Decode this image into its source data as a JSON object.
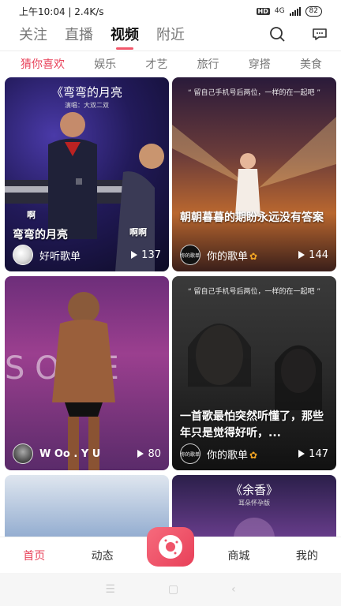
{
  "status": {
    "time": "上午10:04",
    "speed": "2.4K/s",
    "hd": "HD",
    "network": "4G",
    "battery": "82"
  },
  "top_tabs": [
    {
      "label": "关注"
    },
    {
      "label": "直播"
    },
    {
      "label": "视频"
    },
    {
      "label": "附近"
    }
  ],
  "categories": [
    {
      "label": "猜你喜欢"
    },
    {
      "label": "娱乐"
    },
    {
      "label": "才艺"
    },
    {
      "label": "旅行"
    },
    {
      "label": "穿搭"
    },
    {
      "label": "美食"
    }
  ],
  "cards": [
    {
      "song_title": "《弯弯的月亮",
      "song_sub": "演唱：大双二双",
      "tag1": "啊",
      "tag2": "啊啊",
      "title": "弯弯的月亮",
      "author": "好听歌单",
      "plays": "137"
    },
    {
      "banner": "“ 留自己手机号后两位，一样的在一起吧 ”",
      "title": "朝朝暮暮的期盼永远没有答案",
      "author": "你的歌单",
      "avatar_text": "你的歌单",
      "plays": "144"
    },
    {
      "title": "",
      "author": "W Oo . Y U",
      "plays": "80"
    },
    {
      "banner": "“ 留自己手机号后两位，一样的在一起吧 ”",
      "title": "一首歌最怕突然听懂了，那些年只是觉得好听，...",
      "author": "你的歌单",
      "avatar_text": "你的歌单",
      "plays": "147"
    },
    {
      "title": ""
    },
    {
      "song_title": "《余香》",
      "song_sub": "耳朵怀孕版"
    }
  ],
  "bottom_nav": [
    {
      "label": "首页"
    },
    {
      "label": "动态"
    },
    {
      "label": "商城"
    },
    {
      "label": "我的"
    }
  ],
  "colors": {
    "accent": "#e8425a"
  }
}
